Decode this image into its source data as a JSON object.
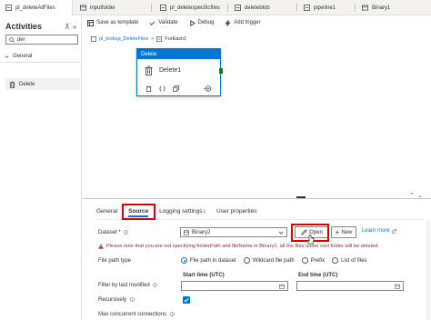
{
  "tabs": [
    {
      "label": "pl_deleteAllFiles",
      "icon": "pipeline-icon",
      "active": true
    },
    {
      "label": "inputfolder",
      "icon": "dataset-icon",
      "active": false
    },
    {
      "label": "pl_deletespecificfiles",
      "icon": "pipeline-icon",
      "active": false
    },
    {
      "label": "deleteblob",
      "icon": "pipeline-icon",
      "active": false
    },
    {
      "label": "pipeline1",
      "icon": "pipeline-icon",
      "active": false
    },
    {
      "label": "Binary1",
      "icon": "dataset-icon",
      "active": false
    }
  ],
  "activities": {
    "title": "Activities",
    "search_value": "del",
    "group": "General",
    "item": "Delete"
  },
  "toolbar": {
    "save_template": "Save as template",
    "validate": "Validate",
    "debug": "Debug",
    "add_trigger": "Add trigger"
  },
  "breadcrumb": {
    "pipeline": "pl_lookup_DeleteFiles",
    "separator": ">",
    "current": "ForEach1"
  },
  "activity_card": {
    "header": "Delete",
    "name": "Delete1"
  },
  "property_tabs": {
    "general": "General",
    "source": "Source",
    "logging": "Logging settings",
    "logging_badge": "1",
    "user_props": "User properties"
  },
  "form": {
    "dataset_label": "Dataset *",
    "dataset_value": "Binary2",
    "open_label": "Open",
    "new_label": "New",
    "learn_more": "Learn more",
    "warning": "Please note that you are not specifying folderPath and fileName in Binary2, all the files under root folder will be deleted.",
    "file_path_type_label": "File path type",
    "radio_options": [
      "File path in dataset",
      "Wildcard file path",
      "Prefix",
      "List of files"
    ],
    "filter_label": "Filter by last modified",
    "start_time_label": "Start time (UTC)",
    "end_time_label": "End time (UTC)",
    "recursively_label": "Recursively",
    "recursively_checked": true,
    "max_conn_label": "Max concurrent connections"
  },
  "colors": {
    "accent": "#0078d4",
    "highlight": "#e00000",
    "warning": "#a4262c"
  }
}
